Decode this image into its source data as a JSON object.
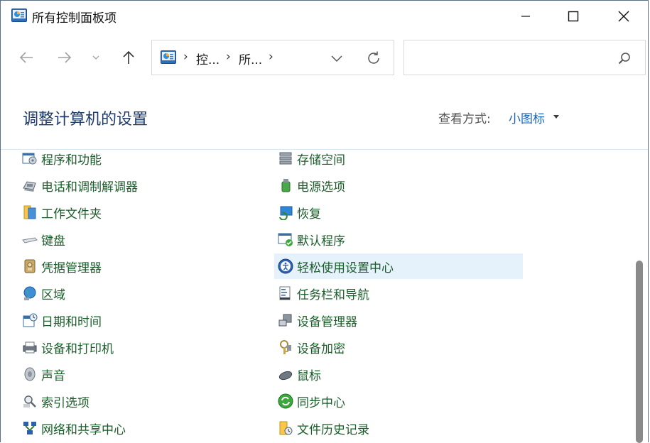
{
  "window": {
    "title": "所有控制面板项"
  },
  "nav": {
    "breadcrumbs": [
      "控...",
      "所..."
    ],
    "separator": "›"
  },
  "search": {
    "placeholder": "",
    "value": ""
  },
  "header": {
    "page_title": "调整计算机的设置",
    "view_by_label": "查看方式:",
    "view_by_value": "小图标"
  },
  "items_left": [
    {
      "label": "程序和功能",
      "icon": "programs-icon"
    },
    {
      "label": "电话和调制解调器",
      "icon": "phone-modem-icon"
    },
    {
      "label": "工作文件夹",
      "icon": "work-folders-icon"
    },
    {
      "label": "键盘",
      "icon": "keyboard-icon"
    },
    {
      "label": "凭据管理器",
      "icon": "credential-icon"
    },
    {
      "label": "区域",
      "icon": "region-icon"
    },
    {
      "label": "日期和时间",
      "icon": "datetime-icon"
    },
    {
      "label": "设备和打印机",
      "icon": "printer-icon"
    },
    {
      "label": "声音",
      "icon": "sound-icon"
    },
    {
      "label": "索引选项",
      "icon": "indexing-icon"
    },
    {
      "label": "网络和共享中心",
      "icon": "network-icon"
    }
  ],
  "items_right": [
    {
      "label": "存储空间",
      "icon": "storage-icon"
    },
    {
      "label": "电源选项",
      "icon": "power-icon"
    },
    {
      "label": "恢复",
      "icon": "recovery-icon"
    },
    {
      "label": "默认程序",
      "icon": "default-programs-icon"
    },
    {
      "label": "轻松使用设置中心",
      "icon": "ease-of-access-icon",
      "selected": true
    },
    {
      "label": "任务栏和导航",
      "icon": "taskbar-icon"
    },
    {
      "label": "设备管理器",
      "icon": "device-manager-icon"
    },
    {
      "label": "设备加密",
      "icon": "encryption-icon"
    },
    {
      "label": "鼠标",
      "icon": "mouse-icon"
    },
    {
      "label": "同步中心",
      "icon": "sync-icon"
    },
    {
      "label": "文件历史记录",
      "icon": "file-history-icon"
    }
  ],
  "colors": {
    "link_green": "#1a5c2a",
    "title_blue": "#1e3a6b",
    "view_blue": "#1a64b8",
    "selected_bg": "#e5f1fb"
  }
}
